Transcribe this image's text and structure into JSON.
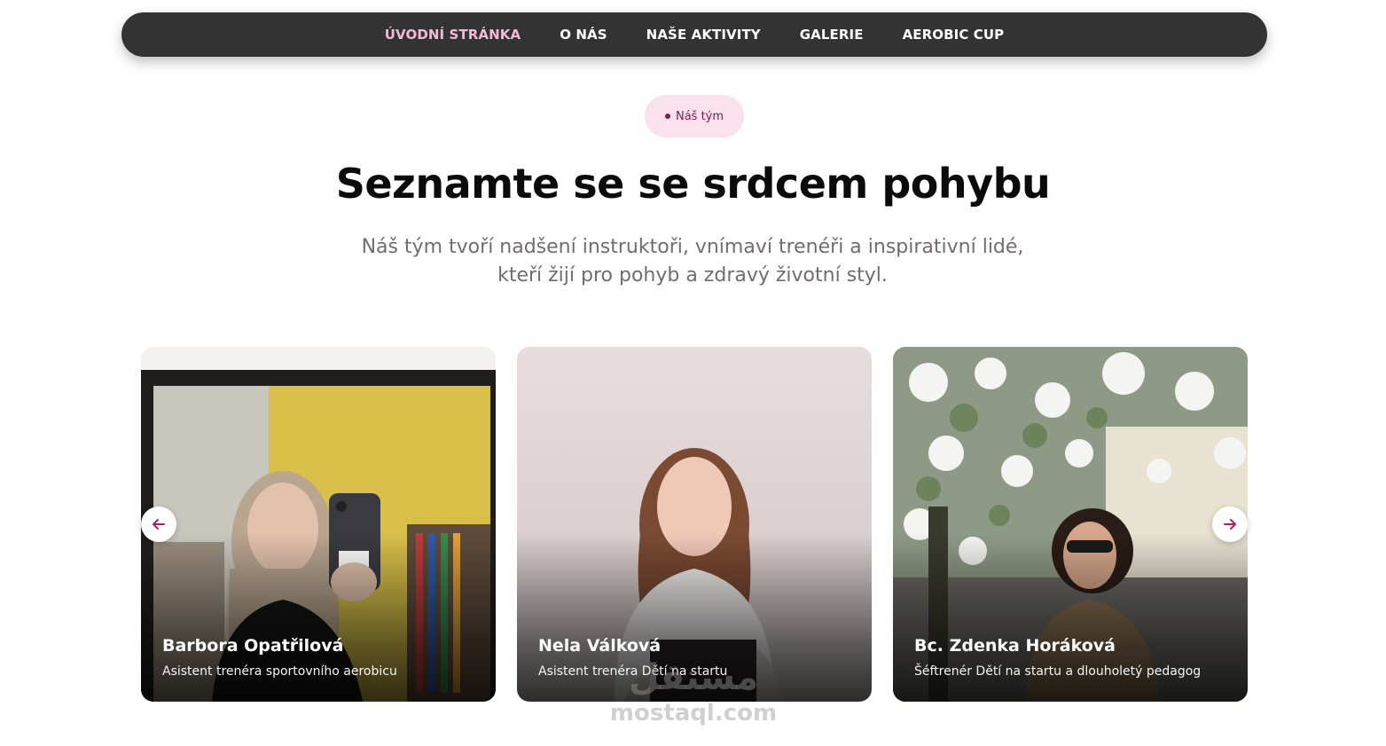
{
  "nav": {
    "items": [
      {
        "label": "ÚVODNÍ STRÁNKA",
        "active": true
      },
      {
        "label": "O NÁS"
      },
      {
        "label": "NAŠE AKTIVITY"
      },
      {
        "label": "GALERIE"
      },
      {
        "label": "AEROBIC CUP"
      }
    ]
  },
  "section": {
    "badge": "Náš tým",
    "title": "Seznamte se se srdcem pohybu",
    "subtitle": "Náš tým tvoří nadšení instruktoři, vnímaví trenéři a inspirativní lidé, kteří žijí pro pohyb a zdravý životní styl."
  },
  "team": [
    {
      "name": "Barbora Opatřilová",
      "role": "Asistent trenéra sportovního aerobicu"
    },
    {
      "name": "Nela Válková",
      "role": "Asistent trenéra Dětí na startu"
    },
    {
      "name": "Bc. Zdenka Horáková",
      "role": "Šéftrenér Dětí na startu a dlouholetý pedagog"
    }
  ],
  "carousel": {
    "prev_icon": "arrow-left-icon",
    "next_icon": "arrow-right-icon"
  },
  "watermark": {
    "arabic": "مستقل",
    "latin": "mostaql.com"
  },
  "colors": {
    "nav_bg": "#333333",
    "nav_active": "#f3b9d9",
    "accent": "#a3245c",
    "badge_bg": "#fbe0ee"
  }
}
